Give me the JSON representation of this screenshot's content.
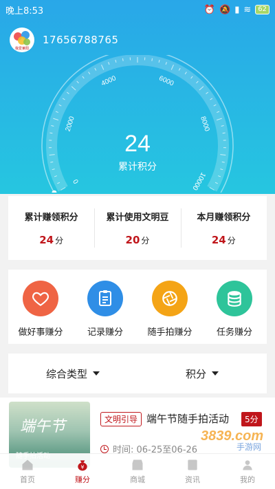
{
  "status": {
    "time": "晚上8:53",
    "battery": "62"
  },
  "profile": {
    "avatar_text": "我爱莱阳",
    "phone": "17656788765"
  },
  "gauge": {
    "ticks": [
      "0",
      "2000",
      "4000",
      "6000",
      "8000",
      "10000"
    ],
    "value": 24,
    "max": 10000,
    "score": "24",
    "label": "累计积分"
  },
  "stats": [
    {
      "label": "累计赚领积分",
      "value": "24",
      "unit": "分"
    },
    {
      "label": "累计使用文明豆",
      "value": "20",
      "unit": "分"
    },
    {
      "label": "本月赚领积分",
      "value": "24",
      "unit": "分"
    }
  ],
  "actions": [
    {
      "label": "做好事赚分",
      "icon": "heart-icon",
      "color": "#ef6444"
    },
    {
      "label": "记录赚分",
      "icon": "clipboard-icon",
      "color": "#2f8ee6"
    },
    {
      "label": "随手拍赚分",
      "icon": "camera-aperture-icon",
      "color": "#f4a416"
    },
    {
      "label": "任务赚分",
      "icon": "database-icon",
      "color": "#2ec49a"
    }
  ],
  "filters": [
    {
      "label": "综合类型"
    },
    {
      "label": "积分"
    }
  ],
  "activity": {
    "thumb_title": "端午节",
    "thumb_sub": "随手拍活动",
    "tag": "文明引导",
    "title": "端午节随手拍活动",
    "points": "5分",
    "time": "时间: 06-25至06-26"
  },
  "watermark": {
    "logo": "3839.com",
    "sub": "手游网"
  },
  "tabs": [
    {
      "label": "首页",
      "icon": "home-icon",
      "active": false
    },
    {
      "label": "赚分",
      "icon": "money-bag-icon",
      "active": true
    },
    {
      "label": "商城",
      "icon": "shop-icon",
      "active": false
    },
    {
      "label": "资讯",
      "icon": "news-icon",
      "active": false
    },
    {
      "label": "我的",
      "icon": "user-icon",
      "active": false
    }
  ],
  "colors": {
    "brand_red": "#c0161b",
    "hero_top": "#29a7e8",
    "hero_bottom": "#26c6e0"
  }
}
